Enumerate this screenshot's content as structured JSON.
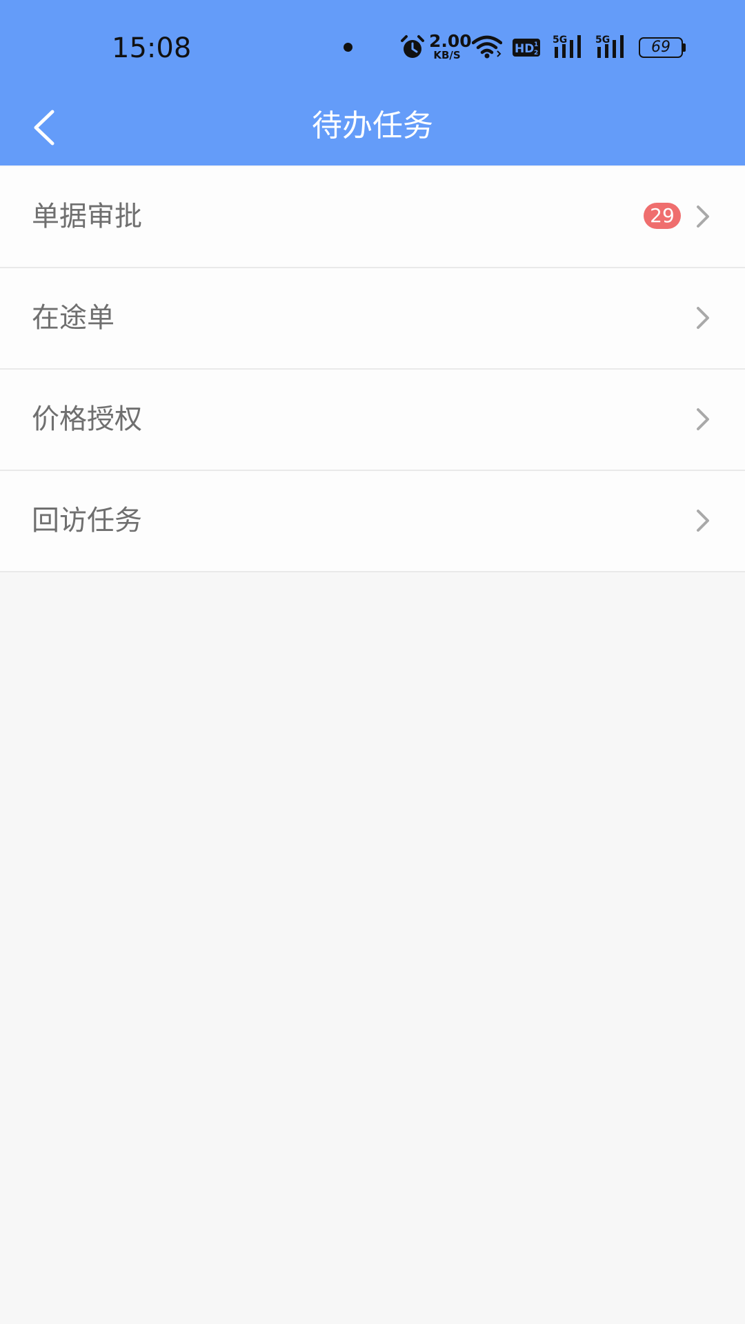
{
  "status_bar": {
    "time": "15:08",
    "net_speed_value": "2.00",
    "net_speed_unit": "KB/S",
    "battery_level": "69",
    "icons": [
      "notification-dot",
      "alarm-icon",
      "wifi-icon",
      "hd-voice-icon",
      "5g-signal-icon",
      "5g-signal-icon",
      "battery-icon"
    ]
  },
  "nav": {
    "title": "待办任务",
    "back_icon": "chevron-left-icon"
  },
  "menu": {
    "items": [
      {
        "label": "单据审批",
        "badge": "29"
      },
      {
        "label": "在途单"
      },
      {
        "label": "价格授权"
      },
      {
        "label": "回访任务"
      }
    ],
    "chevron_icon": "chevron-right-icon"
  },
  "colors": {
    "header_bg": "#649cf9",
    "badge_bg": "#ef6e6e",
    "page_bg": "#f7f7f7",
    "item_bg": "#fdfdfd",
    "label_text": "#6f6f6f"
  }
}
